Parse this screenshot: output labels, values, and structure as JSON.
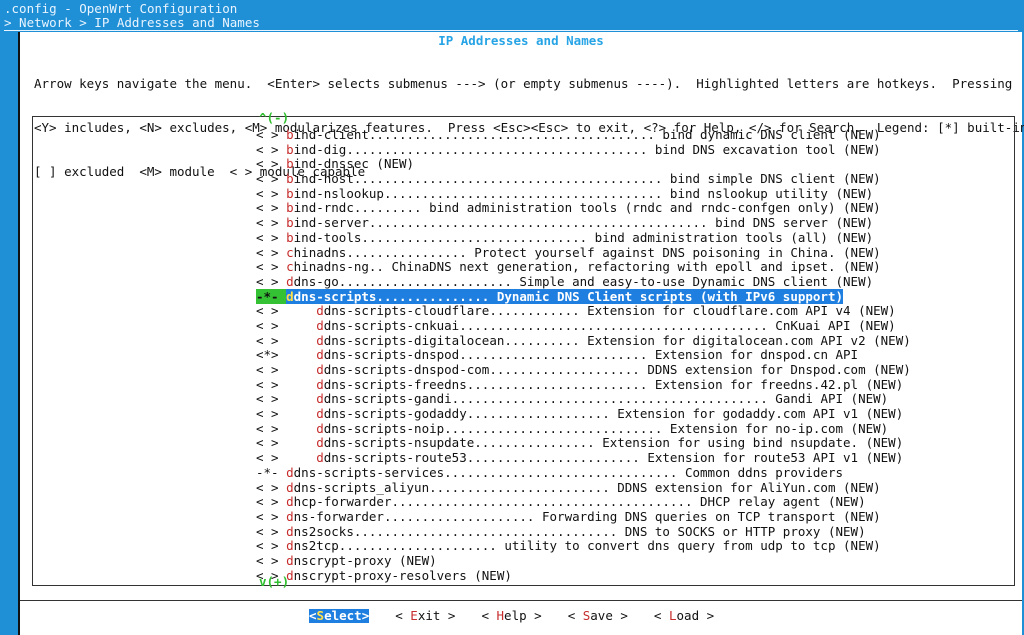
{
  "header": {
    "config_title": ".config - OpenWrt Configuration",
    "breadcrumb": "> Network > IP Addresses and Names"
  },
  "dialog": {
    "title": "IP Addresses and Names",
    "help_lines": [
      "Arrow keys navigate the menu.  <Enter> selects submenus ---> (or empty submenus ----).  Highlighted letters are hotkeys.  Pressing",
      "<Y> includes, <N> excludes, <M> modularizes features.  Press <Esc><Esc> to exit, <?> for Help, </> for Search.  Legend: [*] built-in",
      "[ ] excluded  <M> module  < > module capable"
    ],
    "scroll_up": "^(-)",
    "scroll_down": "v(+)"
  },
  "menu": {
    "items": [
      {
        "mark": "< > ",
        "hotkey": "b",
        "rest": "ind-client...................................... bind dynamic DNS client (NEW)"
      },
      {
        "mark": "< > ",
        "hotkey": "b",
        "rest": "ind-dig........................................ bind DNS excavation tool (NEW)"
      },
      {
        "mark": "< > ",
        "hotkey": "b",
        "rest": "ind-dnssec (NEW)"
      },
      {
        "mark": "< > ",
        "hotkey": "b",
        "rest": "ind-host......................................... bind simple DNS client (NEW)"
      },
      {
        "mark": "< > ",
        "hotkey": "b",
        "rest": "ind-nslookup..................................... bind nslookup utility (NEW)"
      },
      {
        "mark": "< > ",
        "hotkey": "b",
        "rest": "ind-rndc......... bind administration tools (rndc and rndc-confgen only) (NEW)"
      },
      {
        "mark": "< > ",
        "hotkey": "b",
        "rest": "ind-server............................................. bind DNS server (NEW)"
      },
      {
        "mark": "< > ",
        "hotkey": "b",
        "rest": "ind-tools.............................. bind administration tools (all) (NEW)"
      },
      {
        "mark": "< > ",
        "hotkey": "c",
        "rest": "hinadns................ Protect yourself against DNS poisoning in China. (NEW)"
      },
      {
        "mark": "< > ",
        "hotkey": "c",
        "rest": "hinadns-ng.. ChinaDNS next generation, refactoring with epoll and ipset. (NEW)"
      },
      {
        "mark": "< > ",
        "hotkey": "d",
        "rest": "dns-go....................... Simple and easy-to-use Dynamic DNS client (NEW)"
      },
      {
        "mark": "-*- ",
        "hotkey": "d",
        "rest": "dns-scripts............... Dynamic DNS Client scripts (with IPv6 support)",
        "selected": true
      },
      {
        "mark": "< >     ",
        "hotkey": "d",
        "rest": "dns-scripts-cloudflare............ Extension for cloudflare.com API v4 (NEW)"
      },
      {
        "mark": "< >     ",
        "hotkey": "d",
        "rest": "dns-scripts-cnkuai......................................... CnKuai API (NEW)"
      },
      {
        "mark": "< >     ",
        "hotkey": "d",
        "rest": "dns-scripts-digitalocean.......... Extension for digitalocean.com API v2 (NEW)"
      },
      {
        "mark": "<*>     ",
        "hotkey": "d",
        "rest": "dns-scripts-dnspod......................... Extension for dnspod.cn API"
      },
      {
        "mark": "< >     ",
        "hotkey": "d",
        "rest": "dns-scripts-dnspod-com.................... DDNS extension for Dnspod.com (NEW)"
      },
      {
        "mark": "< >     ",
        "hotkey": "d",
        "rest": "dns-scripts-freedns........................ Extension for freedns.42.pl (NEW)"
      },
      {
        "mark": "< >     ",
        "hotkey": "d",
        "rest": "dns-scripts-gandi.......................................... Gandi API (NEW)"
      },
      {
        "mark": "< >     ",
        "hotkey": "d",
        "rest": "dns-scripts-godaddy................... Extension for godaddy.com API v1 (NEW)"
      },
      {
        "mark": "< >     ",
        "hotkey": "d",
        "rest": "dns-scripts-noip............................. Extension for no-ip.com (NEW)"
      },
      {
        "mark": "< >     ",
        "hotkey": "d",
        "rest": "dns-scripts-nsupdate................ Extension for using bind nsupdate. (NEW)"
      },
      {
        "mark": "< >     ",
        "hotkey": "d",
        "rest": "dns-scripts-route53....................... Extension for route53 API v1 (NEW)"
      },
      {
        "mark": "-*- ",
        "hotkey": "d",
        "rest": "dns-scripts-services............................... Common ddns providers"
      },
      {
        "mark": "< > ",
        "hotkey": "d",
        "rest": "dns-scripts_aliyun........................ DDNS extension for AliYun.com (NEW)"
      },
      {
        "mark": "< > ",
        "hotkey": "d",
        "rest": "hcp-forwarder........................................ DHCP relay agent (NEW)"
      },
      {
        "mark": "< > ",
        "hotkey": "d",
        "rest": "ns-forwarder.................... Forwarding DNS queries on TCP transport (NEW)"
      },
      {
        "mark": "< > ",
        "hotkey": "d",
        "rest": "ns2socks................................... DNS to SOCKS or HTTP proxy (NEW)"
      },
      {
        "mark": "< > ",
        "hotkey": "d",
        "rest": "ns2tcp..................... utility to convert dns query from udp to tcp (NEW)"
      },
      {
        "mark": "< > ",
        "hotkey": "d",
        "rest": "nscrypt-proxy (NEW)"
      },
      {
        "mark": "< > ",
        "hotkey": "d",
        "rest": "nscrypt-proxy-resolvers (NEW)"
      }
    ]
  },
  "buttons": [
    {
      "pre": "<",
      "hotkey": "S",
      "rest": "elect>",
      "active": true,
      "name": "select-button"
    },
    {
      "pre": "< ",
      "hotkey": "E",
      "rest": "xit >",
      "active": false,
      "name": "exit-button"
    },
    {
      "pre": "< ",
      "hotkey": "H",
      "rest": "elp >",
      "active": false,
      "name": "help-button"
    },
    {
      "pre": "< ",
      "hotkey": "S",
      "rest": "ave >",
      "active": false,
      "name": "save-button"
    },
    {
      "pre": "< ",
      "hotkey": "L",
      "rest": "oad >",
      "active": false,
      "name": "load-button"
    }
  ]
}
